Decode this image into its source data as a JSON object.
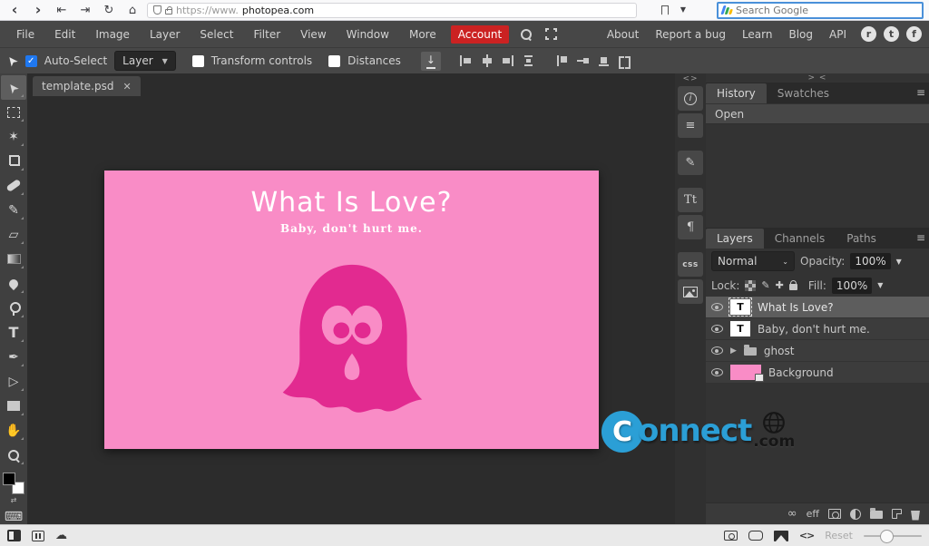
{
  "browser": {
    "url_prefix": "https://www.",
    "url_domain": "photopea.com",
    "search_placeholder": "Search Google",
    "focus_border": "#4a90d9"
  },
  "menubar": {
    "items": [
      "File",
      "Edit",
      "Image",
      "Layer",
      "Select",
      "Filter",
      "View",
      "Window",
      "More"
    ],
    "account": {
      "label": "Account",
      "bg": "#cb2222"
    },
    "links": [
      "About",
      "Report a bug",
      "Learn",
      "Blog",
      "API"
    ],
    "social": [
      "r",
      "t",
      "f"
    ]
  },
  "options_bar": {
    "auto_select": {
      "label": "Auto-Select",
      "checked": true
    },
    "target_dropdown": {
      "value": "Layer"
    },
    "transform_controls": {
      "label": "Transform controls",
      "checked": false
    },
    "distances": {
      "label": "Distances",
      "checked": false
    }
  },
  "tabs": {
    "document": "template.psd",
    "close": "✕"
  },
  "tools": [
    {
      "name": "move-tool",
      "glyph": "➤"
    },
    {
      "name": "rect-select-tool",
      "glyph": ""
    },
    {
      "name": "magic-wand-tool",
      "glyph": "✶"
    },
    {
      "name": "crop-tool",
      "glyph": ""
    },
    {
      "name": "healing-tool",
      "glyph": ""
    },
    {
      "name": "brush-tool",
      "glyph": "✎"
    },
    {
      "name": "eraser-tool",
      "glyph": "▱"
    },
    {
      "name": "gradient-tool",
      "glyph": ""
    },
    {
      "name": "blur-tool",
      "glyph": ""
    },
    {
      "name": "dodge-tool",
      "glyph": ""
    },
    {
      "name": "type-tool",
      "glyph": "T"
    },
    {
      "name": "pen-tool",
      "glyph": "✒"
    },
    {
      "name": "path-select-tool",
      "glyph": "▷"
    },
    {
      "name": "shape-tool",
      "glyph": ""
    },
    {
      "name": "hand-tool",
      "glyph": "✋"
    },
    {
      "name": "zoom-tool",
      "glyph": ""
    }
  ],
  "canvas": {
    "title": "What Is Love?",
    "subtitle": "Baby, don't hurt me.",
    "background_color": "#f98cc6",
    "ghost_color": "#e22a90",
    "text_color": "#ffffff"
  },
  "panel_strip": {
    "collapse_handle": "<>",
    "character_label": "Tt",
    "paragraph_label": "¶",
    "css_label": "css"
  },
  "history_panel": {
    "collapse_handle": "> <",
    "tabs": [
      "History",
      "Swatches"
    ],
    "entries": [
      "Open"
    ]
  },
  "layers_panel": {
    "tabs": [
      "Layers",
      "Channels",
      "Paths"
    ],
    "blend_mode": "Normal",
    "opacity_label": "Opacity:",
    "opacity_value": "100%",
    "lock_label": "Lock:",
    "fill_label": "Fill:",
    "fill_value": "100%",
    "layers": [
      {
        "name": "What Is Love?",
        "kind": "text",
        "selected": true
      },
      {
        "name": "Baby, don't hurt me.",
        "kind": "text",
        "selected": false
      },
      {
        "name": "ghost",
        "kind": "group",
        "selected": false
      },
      {
        "name": "Background",
        "kind": "image",
        "selected": false,
        "thumb_color": "#f98cc6"
      }
    ],
    "effects_label": "eff"
  },
  "status_bar": {
    "reset_label": "Reset",
    "code_glyph": "<>"
  },
  "watermark": {
    "word": "onnect",
    "initial": "C",
    "tld": ".com",
    "color": "#2b9fd6"
  }
}
